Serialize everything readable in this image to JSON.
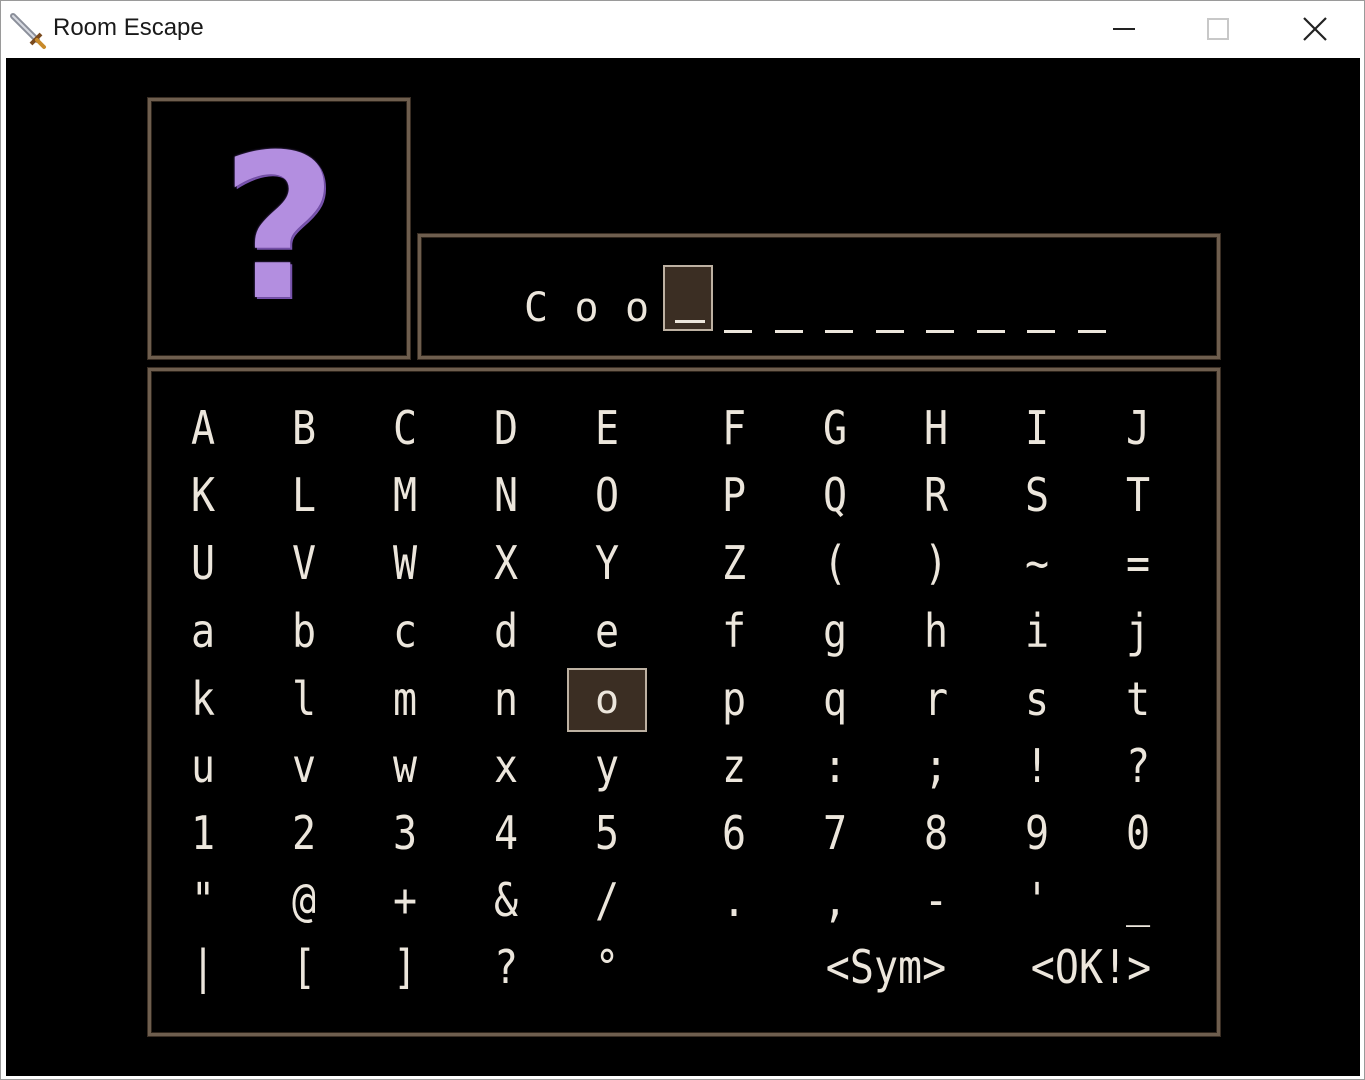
{
  "window": {
    "title": "Room Escape",
    "app_icon": "sword-icon",
    "controls": [
      "minimize-icon",
      "maximize-icon",
      "close-icon"
    ]
  },
  "portrait": {
    "symbol": "?",
    "color": "#b38ee0"
  },
  "name_entry": {
    "entered": [
      "C",
      "o",
      "o"
    ],
    "cursor_index": 3,
    "max_length": 12
  },
  "keyboard": {
    "rows": [
      [
        "A",
        "B",
        "C",
        "D",
        "E",
        "F",
        "G",
        "H",
        "I",
        "J"
      ],
      [
        "K",
        "L",
        "M",
        "N",
        "O",
        "P",
        "Q",
        "R",
        "S",
        "T"
      ],
      [
        "U",
        "V",
        "W",
        "X",
        "Y",
        "Z",
        "(",
        ")",
        "~",
        "="
      ],
      [
        "a",
        "b",
        "c",
        "d",
        "e",
        "f",
        "g",
        "h",
        "i",
        "j"
      ],
      [
        "k",
        "l",
        "m",
        "n",
        "o",
        "p",
        "q",
        "r",
        "s",
        "t"
      ],
      [
        "u",
        "v",
        "w",
        "x",
        "y",
        "z",
        ":",
        ";",
        "!",
        "?"
      ],
      [
        "1",
        "2",
        "3",
        "4",
        "5",
        "6",
        "7",
        "8",
        "9",
        "0"
      ],
      [
        "\"",
        "@",
        "+",
        "&",
        "/",
        ".",
        ",",
        "-",
        "'",
        "_"
      ],
      [
        "|",
        "[",
        "]",
        "?",
        "°"
      ]
    ],
    "commands": {
      "sym": "<Sym>",
      "ok": "<OK!>"
    },
    "selected": "o"
  },
  "colors": {
    "text": "#ece6dc",
    "border": "#6e5e4e",
    "highlight_bg": "#3b2e23",
    "highlight_border": "#bdb1a2",
    "background": "#000000"
  }
}
